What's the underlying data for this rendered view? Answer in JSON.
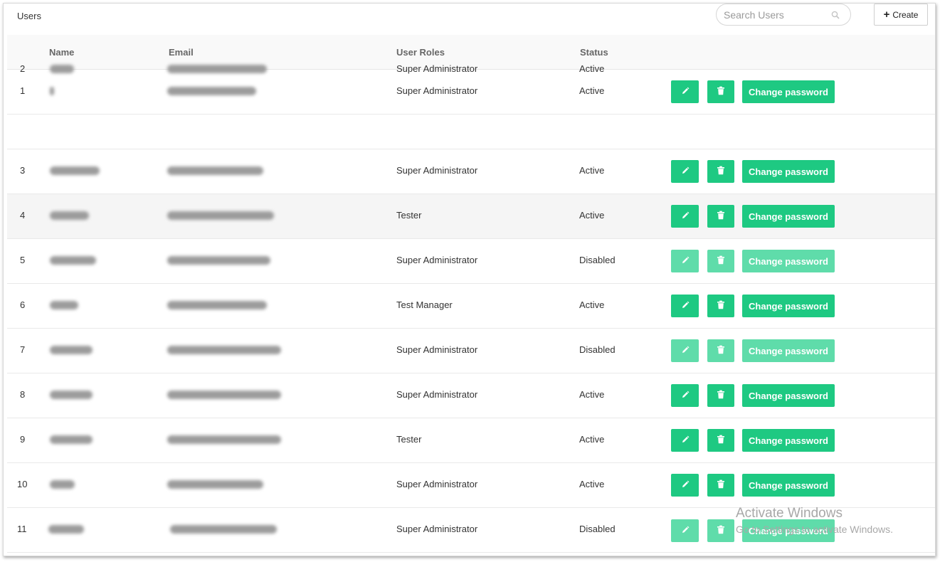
{
  "header": {
    "title": "Users",
    "search_placeholder": "Search Users",
    "create_label": "Create"
  },
  "columns": [
    "Name",
    "Email",
    "User Roles",
    "Status"
  ],
  "actions": {
    "change_password_label": "Change password"
  },
  "rows": [
    {
      "num": "1",
      "role": "Super Administrator",
      "status": "Active",
      "actions": "enabled"
    },
    {
      "num": "2",
      "role": "Super Administrator",
      "status": "Active",
      "actions": "none"
    },
    {
      "num": "3",
      "role": "Super Administrator",
      "status": "Active",
      "actions": "enabled"
    },
    {
      "num": "4",
      "role": "Tester",
      "status": "Active",
      "actions": "enabled"
    },
    {
      "num": "5",
      "role": "Super Administrator",
      "status": "Disabled",
      "actions": "disabled"
    },
    {
      "num": "6",
      "role": "Test Manager",
      "status": "Active",
      "actions": "enabled"
    },
    {
      "num": "7",
      "role": "Super Administrator",
      "status": "Disabled",
      "actions": "disabled"
    },
    {
      "num": "8",
      "role": "Super Administrator",
      "status": "Active",
      "actions": "enabled"
    },
    {
      "num": "9",
      "role": "Tester",
      "status": "Active",
      "actions": "enabled"
    },
    {
      "num": "10",
      "role": "Super Administrator",
      "status": "Active",
      "actions": "enabled"
    },
    {
      "num": "11",
      "role": "Super Administrator",
      "status": "Disabled",
      "actions": "disabled"
    }
  ],
  "watermark": {
    "line1": "Activate Windows",
    "line2": "Go to Settings to activate Windows."
  },
  "colors": {
    "accent": "#1ec982",
    "accent_disabled": "#5fdcaa"
  }
}
